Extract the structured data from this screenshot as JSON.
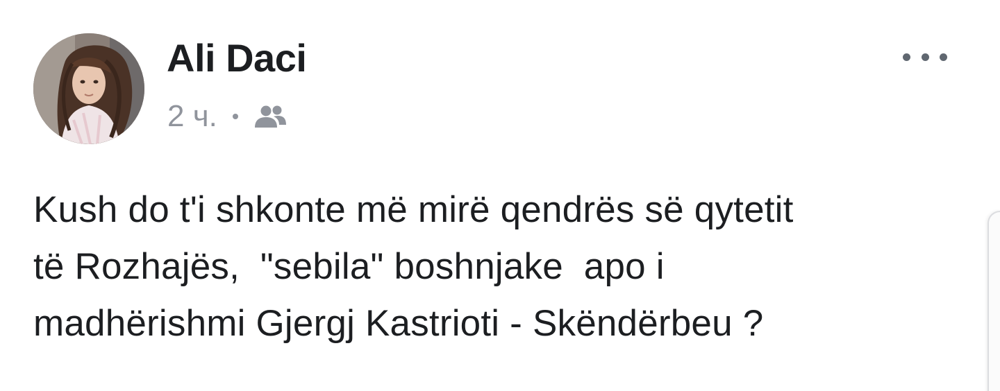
{
  "post": {
    "author": "Ali Daci",
    "timestamp": "2 ч.",
    "separator": "•",
    "audience_icon": "friends-icon",
    "menu_icon": "more-horizontal-icon",
    "text": "Kush do t'i shkonte më mirë qendrës së qytetit\ntë Rozhajës,  \"sebila\" boshnjake  apo i\nmadhërishmi Gjergj Kastrioti - Skëndërbeu ?"
  },
  "colors": {
    "name_text": "#1c1e21",
    "meta_text": "#90949c",
    "icon": "#606770"
  }
}
